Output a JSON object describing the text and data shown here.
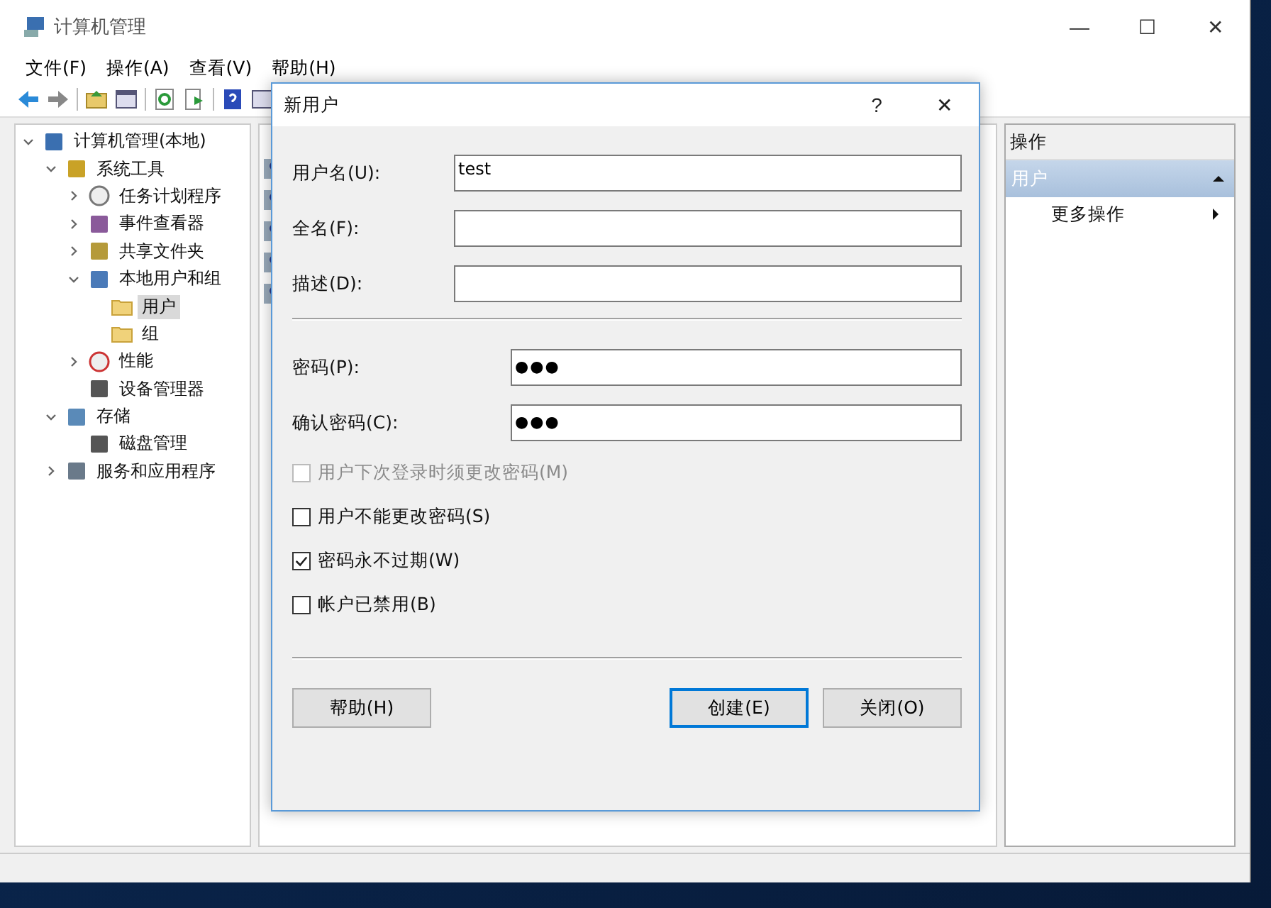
{
  "window": {
    "title": "计算机管理",
    "controls": [
      "—",
      "☐",
      "✕"
    ]
  },
  "menu": [
    "文件(F)",
    "操作(A)",
    "查看(V)",
    "帮助(H)"
  ],
  "tree": [
    {
      "label": "计算机管理(本地)",
      "expanded": true,
      "selected": false,
      "children": [
        {
          "label": "系统工具",
          "expanded": true,
          "selected": false,
          "children": [
            {
              "label": "任务计划程序",
              "expanded": false,
              "selected": false
            },
            {
              "label": "事件查看器",
              "expanded": false,
              "selected": false
            },
            {
              "label": "共享文件夹",
              "expanded": false,
              "selected": false
            },
            {
              "label": "本地用户和组",
              "expanded": true,
              "selected": false,
              "children": [
                {
                  "label": "用户",
                  "kind": "folder",
                  "selected": true
                },
                {
                  "label": "组",
                  "kind": "folder",
                  "selected": false
                }
              ]
            },
            {
              "label": "性能",
              "expanded": false,
              "selected": false
            },
            {
              "label": "设备管理器",
              "selected": false
            }
          ]
        },
        {
          "label": "存储",
          "expanded": true,
          "selected": false,
          "children": [
            {
              "label": "磁盘管理",
              "selected": false
            }
          ]
        },
        {
          "label": "服务和应用程序",
          "expanded": false,
          "selected": false
        }
      ]
    }
  ],
  "list_items": [
    {
      "kind": "user"
    },
    {
      "kind": "user"
    },
    {
      "kind": "user"
    },
    {
      "kind": "user"
    },
    {
      "kind": "user"
    }
  ],
  "actions": {
    "header": "操作",
    "section": "用户",
    "section_expanded": true,
    "items": [
      "更多操作"
    ]
  },
  "dialog": {
    "title": "新用户",
    "help_glyph": "?",
    "close_glyph": "✕",
    "fields": [
      {
        "label": "用户名(U):",
        "value": "test",
        "kind": "text"
      },
      {
        "label": "全名(F):",
        "kind": "text"
      },
      {
        "label": "描述(D):",
        "kind": "text"
      },
      {
        "label": "密码(P):",
        "value": "●●●",
        "kind": "password"
      },
      {
        "label": "确认密码(C):",
        "value": "●●●",
        "kind": "password"
      }
    ],
    "options": [
      {
        "label": "用户下次登录时须更改密码(M)",
        "checked": false,
        "disabled": true
      },
      {
        "label": "用户不能更改密码(S)",
        "checked": false,
        "disabled": false
      },
      {
        "label": "密码永不过期(W)",
        "checked": true,
        "disabled": false
      },
      {
        "label": "帐户已禁用(B)",
        "checked": false,
        "disabled": false
      }
    ],
    "buttons": [
      {
        "label": "帮助(H)",
        "default": false
      },
      {
        "label": "创建(E)",
        "default": true
      },
      {
        "label": "关闭(O)",
        "default": false
      }
    ]
  }
}
